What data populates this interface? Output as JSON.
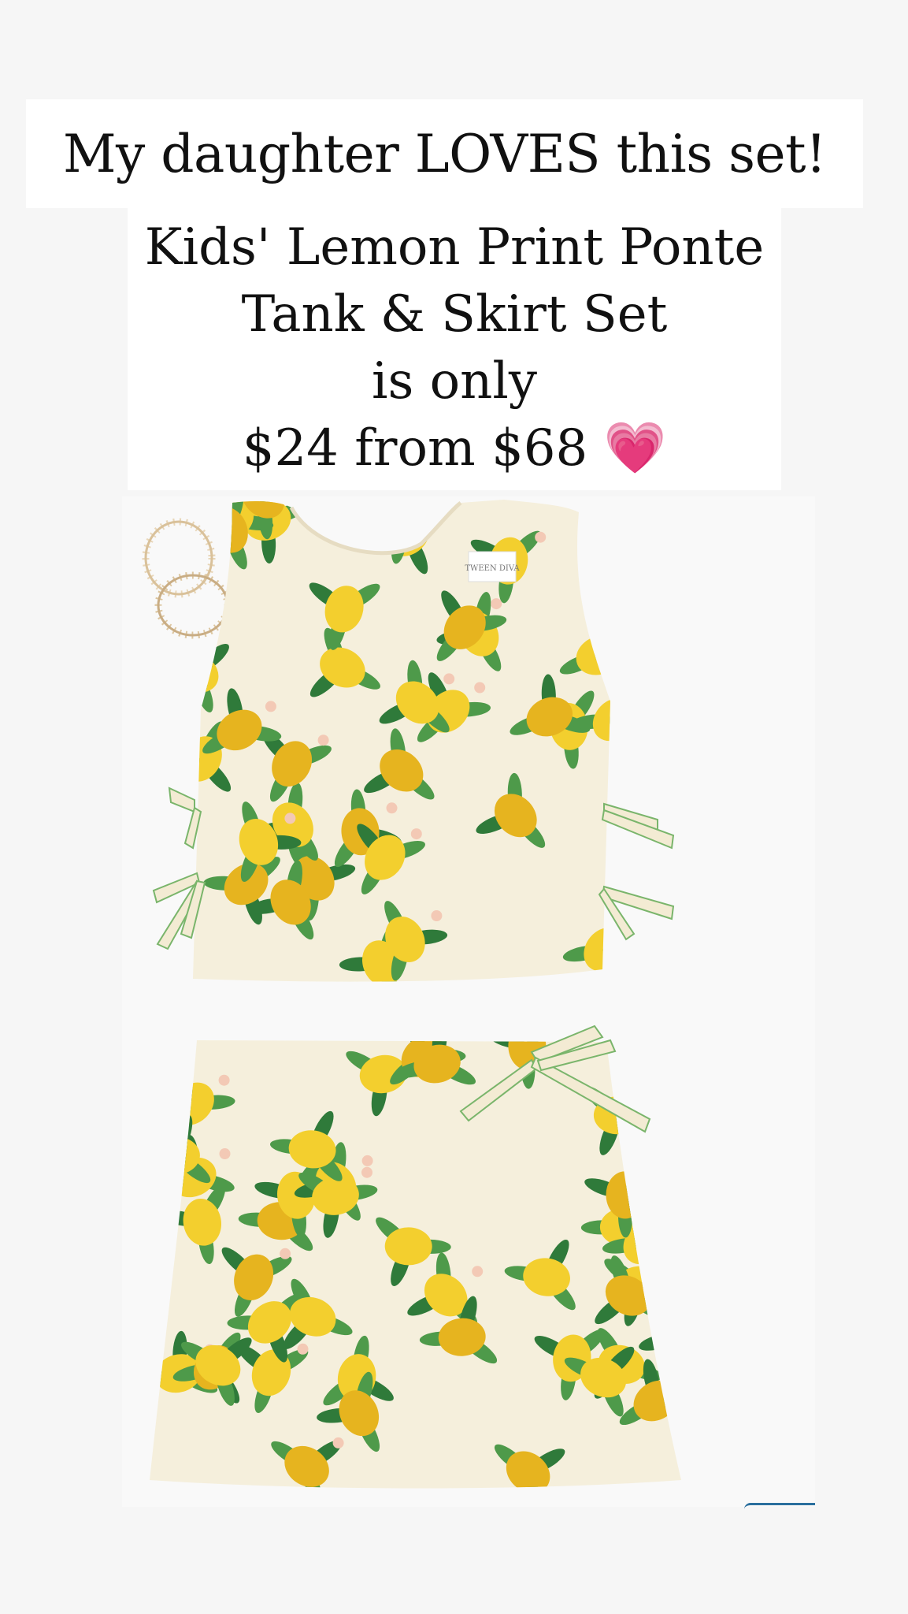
{
  "story": {
    "headline": "My daughter LOVES this set!",
    "product_name_line1": "Kids' Lemon Print Ponte",
    "product_name_line2": "Tank & Skirt Set",
    "price_intro": "is only",
    "price_line": "$24 from $68",
    "heart_emoji": "💗"
  },
  "product_image": {
    "brand_tag": "TWEEN DIVA",
    "print": "lemon-print",
    "colors": {
      "fabric": "#f5efdc",
      "lemon": "#f3cf2e",
      "lemon_shade": "#e6b41f",
      "leaf": "#4e9a4a",
      "leaf_dark": "#2f7a3a",
      "blossom": "#f3c9b5"
    }
  }
}
